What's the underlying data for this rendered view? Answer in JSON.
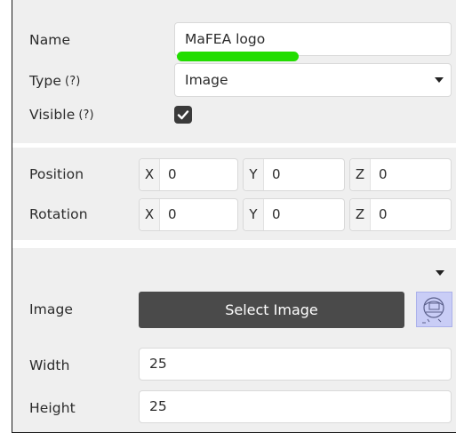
{
  "general": {
    "name_label": "Name",
    "name_value": "MaFEA logo",
    "type_label": "Type",
    "type_value": "Image",
    "visible_label": "Visible",
    "visible_checked": true,
    "help_glyph": "?"
  },
  "position": {
    "label": "Position",
    "x_axis": "X",
    "x_value": "0",
    "y_axis": "Y",
    "y_value": "0",
    "z_axis": "Z",
    "z_value": "0"
  },
  "rotation": {
    "label": "Rotation",
    "x_axis": "X",
    "x_value": "0",
    "y_axis": "Y",
    "y_value": "0",
    "z_axis": "Z",
    "z_value": "0"
  },
  "image": {
    "label": "Image",
    "select_button": "Select Image",
    "width_label": "Width",
    "width_value": "25",
    "height_label": "Height",
    "height_value": "25"
  },
  "icons": {
    "type_select": "chevron-down-icon",
    "image_dropdown": "chevron-down-icon",
    "checkbox": "checkmark-icon",
    "help": "question-circle-icon",
    "thumbnail": "image-thumbnail-icon"
  },
  "colors": {
    "highlight": "#22dd00",
    "button": "#4a4a4a",
    "panel": "#efefef",
    "thumbnail": "#c9cdf6"
  }
}
